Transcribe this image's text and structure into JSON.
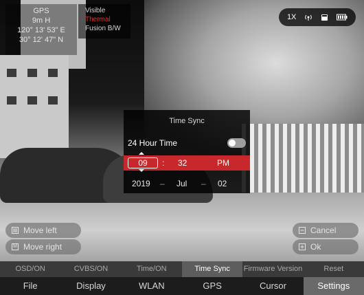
{
  "gps": {
    "title": "GPS",
    "altitude": "9m H",
    "longitude": "120° 13' 53\" E",
    "latitude": "30° 12' 47\" N"
  },
  "modes": {
    "visible": "Visible",
    "thermal": "Thermal",
    "fusion": "Fusion B/W",
    "active_color": "#e0322f"
  },
  "status": {
    "zoom": "1X",
    "icons": [
      "signal-icon",
      "sd-card-icon",
      "battery-icon"
    ]
  },
  "dialog": {
    "title": "Time Sync",
    "hour24_label": "24 Hour Time",
    "hour24_enabled": false,
    "time": {
      "hour": "09",
      "separator": ":",
      "minute": "32",
      "ampm": "PM"
    },
    "date": {
      "year": "2019",
      "month": "Jul",
      "day": "02",
      "dash": "–"
    },
    "highlight_color": "#c8282b"
  },
  "side_buttons": {
    "move_left": {
      "key": "",
      "label": "Move left"
    },
    "move_right": {
      "key": "M",
      "label": "Move right"
    },
    "cancel": {
      "key": "",
      "label": "Cancel"
    },
    "ok": {
      "key": "",
      "label": "Ok"
    }
  },
  "subtabs": [
    "OSD/ON",
    "CVBS/ON",
    "Time/ON",
    "Time Sync",
    "Firmware Version",
    "Reset"
  ],
  "subtab_active": "Time Sync",
  "maintabs": [
    "File",
    "Display",
    "WLAN",
    "GPS",
    "Cursor",
    "Settings"
  ],
  "maintab_active": "Settings"
}
